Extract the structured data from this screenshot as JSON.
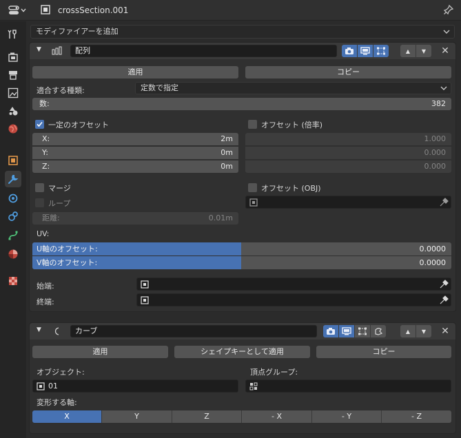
{
  "header": {
    "title": "crossSection.001"
  },
  "add_modifier": {
    "label": "モディファイアーを追加"
  },
  "array": {
    "name": "配列",
    "apply_label": "適用",
    "copy_label": "コピー",
    "fit_type_label": "適合する種類:",
    "fit_type_value": "定数で指定",
    "count_label": "数:",
    "count_value": "382",
    "constant_offset": {
      "label": "一定のオフセット",
      "checked": true,
      "x_label": "X:",
      "x_value": "2m",
      "y_label": "Y:",
      "y_value": "0m",
      "z_label": "Z:",
      "z_value": "0m"
    },
    "relative_offset": {
      "label": "オフセット (倍率)",
      "checked": false,
      "x_value": "1.000",
      "y_value": "0.000",
      "z_value": "0.000"
    },
    "merge": {
      "label": "マージ",
      "checked": false
    },
    "object_offset": {
      "label": "オフセット (OBJ)",
      "checked": false
    },
    "loop": {
      "label": "ループ",
      "checked": false
    },
    "distance_label": "距離:",
    "distance_value": "0.01m",
    "uv_label": "UV:",
    "u_offset_label": "U軸のオフセット:",
    "u_offset_value": "0.0000",
    "v_offset_label": "V軸のオフセット:",
    "v_offset_value": "0.0000",
    "start_cap_label": "始端:",
    "end_cap_label": "終端:"
  },
  "curve": {
    "name": "カーブ",
    "apply_label": "適用",
    "apply_shape_label": "シェイプキーとして適用",
    "copy_label": "コピー",
    "object_label": "オブジェクト:",
    "object_value": "01",
    "vertex_group_label": "頂点グループ:",
    "deform_axis_label": "変形する軸:",
    "axes": [
      "X",
      "Y",
      "Z",
      "- X",
      "- Y",
      "- Z"
    ],
    "active_axis": "X"
  },
  "colors": {
    "accent": "#4772b3",
    "background": "#2b2b2b",
    "panel": "#303030",
    "widget": "#545454"
  }
}
